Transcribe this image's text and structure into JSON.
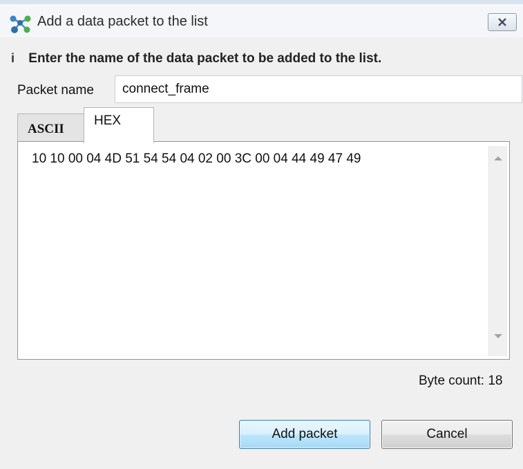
{
  "window": {
    "title": "Add a data packet to the list",
    "icon": "network-nodes-icon",
    "close_icon": "close-icon"
  },
  "info": {
    "icon": "info-icon",
    "icon_glyph": "i",
    "message": "Enter the name of the data packet to be added to the list."
  },
  "packet": {
    "label": "Packet name",
    "value": "connect_frame"
  },
  "tabs": [
    {
      "label": "ASCII",
      "selected": false
    },
    {
      "label": "HEX",
      "selected": true
    }
  ],
  "hex_content": "10 10 00 04 4D 51 54 54 04 02 00 3C 00 04 44 49 47 49",
  "byte_count": "Byte count: 18",
  "buttons": {
    "add": "Add packet",
    "cancel": "Cancel"
  },
  "colors": {
    "accent": "#3c7fb1",
    "background": "#f0f0f0"
  }
}
